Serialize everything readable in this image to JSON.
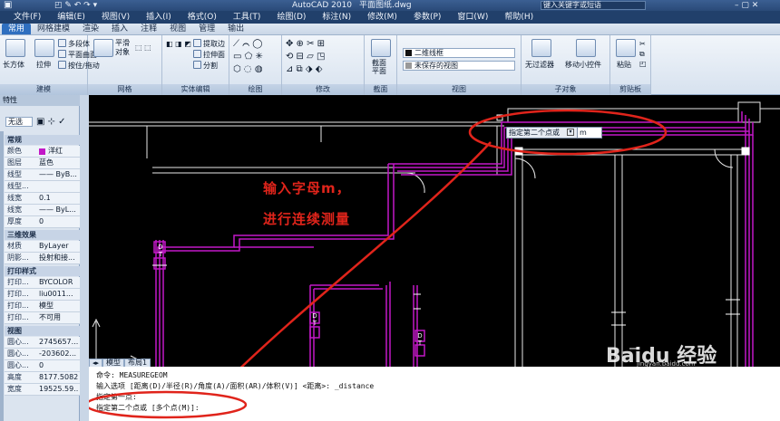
{
  "window": {
    "app_title": "AutoCAD 2010",
    "file": "平面图纸.dwg",
    "search_placeholder": "键入关键字或短语"
  },
  "menu": [
    "文件(F)",
    "编辑(E)",
    "视图(V)",
    "插入(I)",
    "格式(O)",
    "工具(T)",
    "绘图(D)",
    "标注(N)",
    "修改(M)",
    "参数(P)",
    "窗口(W)",
    "帮助(H)"
  ],
  "ribbon_tabs": [
    "常用",
    "网格建模",
    "渲染",
    "插入",
    "注释",
    "视图",
    "管理",
    "输出"
  ],
  "ribbon": {
    "panels": [
      "建模",
      "网格",
      "实体编辑",
      "绘图",
      "修改",
      "截面",
      "视图",
      "子对象",
      "剪贴板"
    ],
    "buttons": {
      "box": "长方体",
      "extrude": "拉伸",
      "polysolid": "多段体",
      "planar": "平面曲面",
      "loft": "按住/拖动",
      "smooth": "平滑对象",
      "extract": "提取边",
      "extrude_face": "拉伸面",
      "separate": "分割",
      "section_plane": "截面平面",
      "no_filter": "无过滤器",
      "gizmo": "移动小控件",
      "paste": "粘贴"
    },
    "style_select": "二维线框",
    "view_select": "未保存的视图"
  },
  "properties": {
    "title": "特性",
    "selection": "无选",
    "general_header": "常规",
    "general": [
      {
        "k": "颜色",
        "v": "洋红"
      },
      {
        "k": "图层",
        "v": "蓝色"
      },
      {
        "k": "线型",
        "v": "—— ByB..."
      },
      {
        "k": "线型...",
        "v": ""
      },
      {
        "k": "线宽",
        "v": "0.1"
      },
      {
        "k": "线宽",
        "v": "—— ByL..."
      },
      {
        "k": "厚度",
        "v": "0"
      }
    ],
    "3d_header": "三维效果",
    "3d": [
      {
        "k": "材质",
        "v": "ByLayer"
      },
      {
        "k": "阴影...",
        "v": "投射和接..."
      }
    ],
    "print_header": "打印样式",
    "print": [
      {
        "k": "打印...",
        "v": "BYCOLOR"
      },
      {
        "k": "打印...",
        "v": "liu0011..."
      },
      {
        "k": "打印...",
        "v": "模型"
      },
      {
        "k": "打印...",
        "v": "不可用"
      }
    ],
    "view_header": "视图",
    "view": [
      {
        "k": "圆心...",
        "v": "2745657..."
      },
      {
        "k": "圆心...",
        "v": "-203602..."
      },
      {
        "k": "圆心...",
        "v": "0"
      },
      {
        "k": "高度",
        "v": "8177.5082"
      },
      {
        "k": "宽度",
        "v": "19525.59..."
      }
    ]
  },
  "canvas": {
    "tooltip_label": "指定第二个点或",
    "tooltip_input": "m",
    "annotation_line1": "输入字母m，",
    "annotation_line2": "进行连续测量",
    "dt_label": "D T",
    "watermark": "Baidu 经验",
    "watermark_url": "jingyan.baidu.com",
    "model_tabs": [
      "模型",
      "布局1"
    ]
  },
  "command": {
    "line1": "命令:  MEASUREGEOM",
    "line2": "输入选项 [距离(D)/半径(R)/角度(A)/面积(AR)/体积(V)] <距离>: _distance",
    "line3": "指定第一点:",
    "line4": "指定第二个点或 [多个点(M)]:"
  },
  "colors": {
    "magenta": "#c218c7",
    "red": "#e0241b",
    "canvas": "#000000"
  }
}
